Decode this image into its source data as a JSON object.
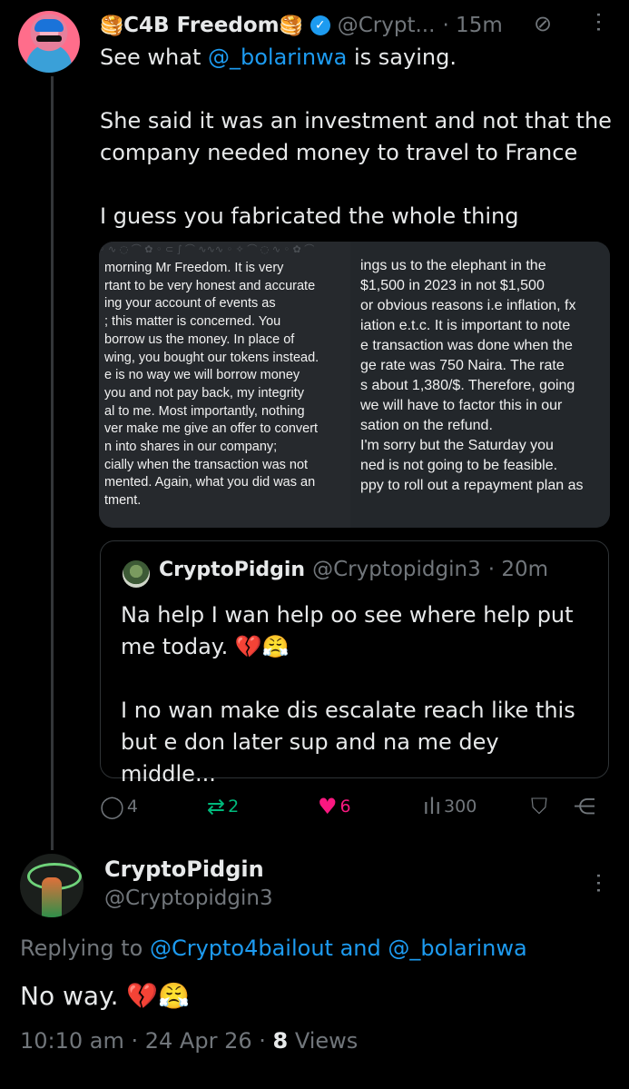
{
  "main_tweet": {
    "name": "C4B Freedom",
    "name_emoji_left": "🥞",
    "name_emoji_right": "🥞",
    "handle": "@Crypt...",
    "time": "· 15m",
    "body_prefix": "See what ",
    "body_mention": "@_bolarinwa",
    "body_suffix": " is saying.\n\nShe said it was an investment and not that the company needed money to travel to France\n\nI guess you fabricated the whole thing",
    "icons": {
      "verified": "verified-badge-icon",
      "grok": "grok-icon",
      "more": "more-vertical-icon"
    }
  },
  "media": {
    "left_image_lines": [
      "morning Mr Freedom. It is very",
      "rtant to be very honest and accurate",
      "ing your account of events as",
      "; this matter is concerned. You",
      " borrow us the money. In place of",
      "wing, you bought our tokens instead.",
      "e is no way we will borrow money",
      "you and not pay back, my integrity",
      "al to me. Most importantly, nothing",
      "ver make me give an offer to convert",
      "n into shares in our company;",
      "cially when the transaction was not",
      "mented. Again, what you did was an",
      "tment."
    ],
    "right_image_lines": [
      "ings us to the elephant in the",
      "$1,500 in 2023 in not $1,500",
      "or obvious reasons i.e inflation, fx",
      "iation e.t.c. It is important to note",
      "e transaction was done when the",
      "ge rate was 750 Naira. The rate",
      "s about 1,380/$. Therefore, going",
      " we will have to factor this in our",
      "sation on the refund.",
      "I'm sorry but the Saturday you",
      "ned is not going to be feasible.",
      "ppy to roll out a repayment plan as"
    ]
  },
  "quote_tweet": {
    "name": "CryptoPidgin",
    "handle": "@Cryptopidgin3",
    "time": "· 20m",
    "body": "Na help I wan help oo see where help put me today. 💔😤\n\nI no wan make dis escalate reach like this but e don later sup and na me dey middle..."
  },
  "actions": {
    "replies": "4",
    "reposts": "2",
    "likes": "6",
    "views": "300",
    "icons": [
      "reply-icon",
      "repost-icon",
      "like-icon",
      "views-icon",
      "bookmark-icon",
      "share-icon"
    ]
  },
  "reply_tweet": {
    "name": "CryptoPidgin",
    "handle": "@Cryptopidgin3",
    "replying_label": "Replying to ",
    "replying_mentions": "@Crypto4bailout and @_bolarinwa",
    "text": "No way. 💔😤",
    "time": "10:10 am · 24 Apr 26 · ",
    "views_count": "8",
    "views_label": " Views"
  },
  "colors": {
    "background": "#000000",
    "accent": "#1d9bf0",
    "secondary_text": "#71767b",
    "like": "#f91880",
    "repost": "#00ba7c"
  }
}
